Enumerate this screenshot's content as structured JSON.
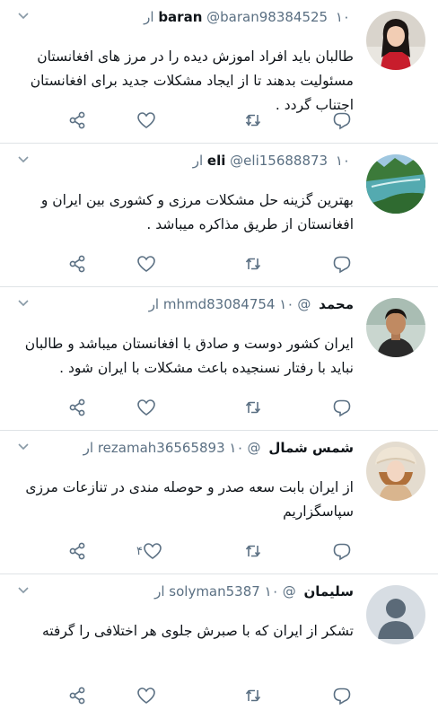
{
  "colors": {
    "text": "#0f1419",
    "muted": "#5b7083",
    "divider": "#dfe3e6"
  },
  "tweets": [
    {
      "name": "baran",
      "handle": "@baran98384525",
      "time": "۱۰ ار",
      "text": "طالبان باید افراد اموزش دیده را در مرز های افغانستان مسئولیت بدهند تا از ایجاد مشکلات جدید برای افغانستان اجتناب گردد .",
      "like_count": "",
      "avatar": "woman-portrait"
    },
    {
      "name": "eli",
      "handle": "@eli15688873",
      "time": "۱۰ ار",
      "text": "بهترین گزینه حل مشکلات مرزی و کشوری بین ایران و افغانستان از طریق مذاکره میباشد .",
      "like_count": "",
      "avatar": "river-landscape"
    },
    {
      "name": "محمد",
      "handle": "@mhmd83084754",
      "time": "۱۰ ار",
      "text": "ایران کشور دوست و صادق با افغانستان میباشد و طالبان نباید با رفتار نسنجیده باعث مشکلات با ایران شود .",
      "like_count": "",
      "avatar": "man-portrait"
    },
    {
      "name": "شمس شمال",
      "handle": "@rezamah36565893",
      "time": "۱۰ ار",
      "text": "از ایران بابت سعه صدر و حوصله مندی در تنازعات مرزی سپاسگزاریم",
      "like_count": "۴",
      "avatar": "woman-fur-hat"
    },
    {
      "name": "سلیمان",
      "handle": "@solyman5387",
      "time": "۱۰ ار",
      "text": "تشکر از ایران که با صبرش جلوی هر اختلافی را گرفته",
      "like_count": "",
      "avatar": "default-avatar"
    }
  ]
}
